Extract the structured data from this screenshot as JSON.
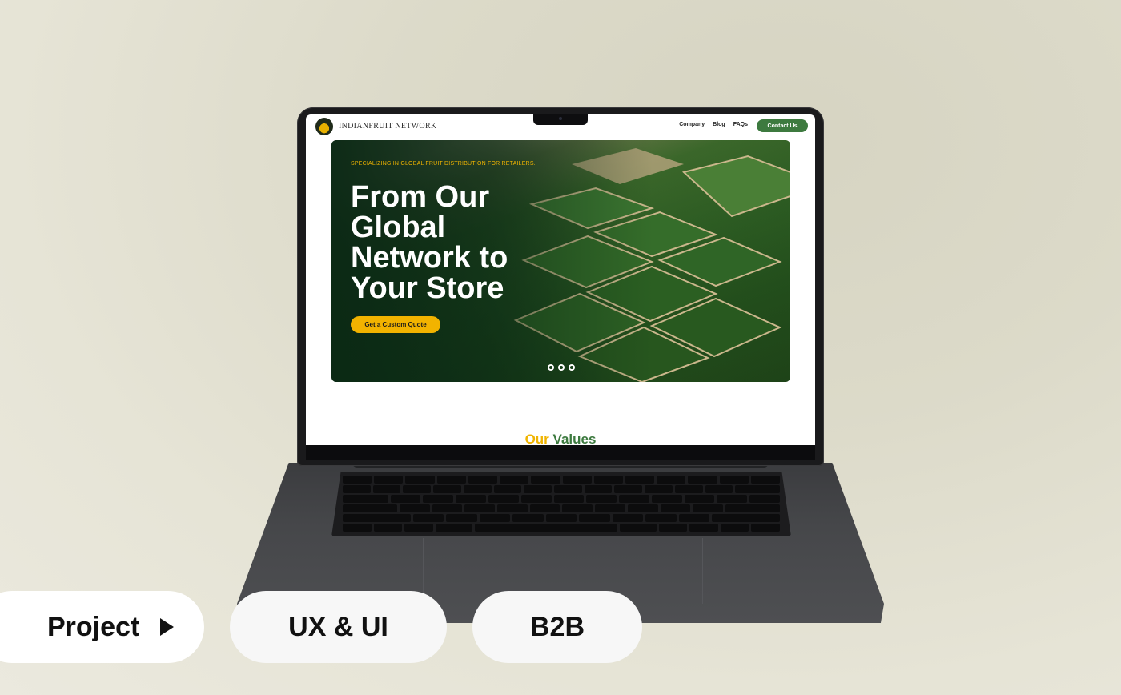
{
  "site": {
    "brand": "INDIANFRUIT NETWORK",
    "nav": [
      {
        "label": "Company"
      },
      {
        "label": "Blog"
      },
      {
        "label": "FAQs"
      }
    ],
    "contact_label": "Contact Us",
    "hero": {
      "tagline": "SPECIALIZING IN GLOBAL FRUIT DISTRIBUTION FOR RETAILERS.",
      "title": "From Our Global Network to Your Store",
      "cta_label": "Get a Custom Quote"
    },
    "values_title": {
      "part1": "Our",
      "part2": "Values"
    }
  },
  "tags": {
    "project": "Project",
    "ux": "UX & UI",
    "b2b": "B2B"
  },
  "colors": {
    "accent_green": "#3d7a3f",
    "accent_yellow": "#f2b300"
  }
}
